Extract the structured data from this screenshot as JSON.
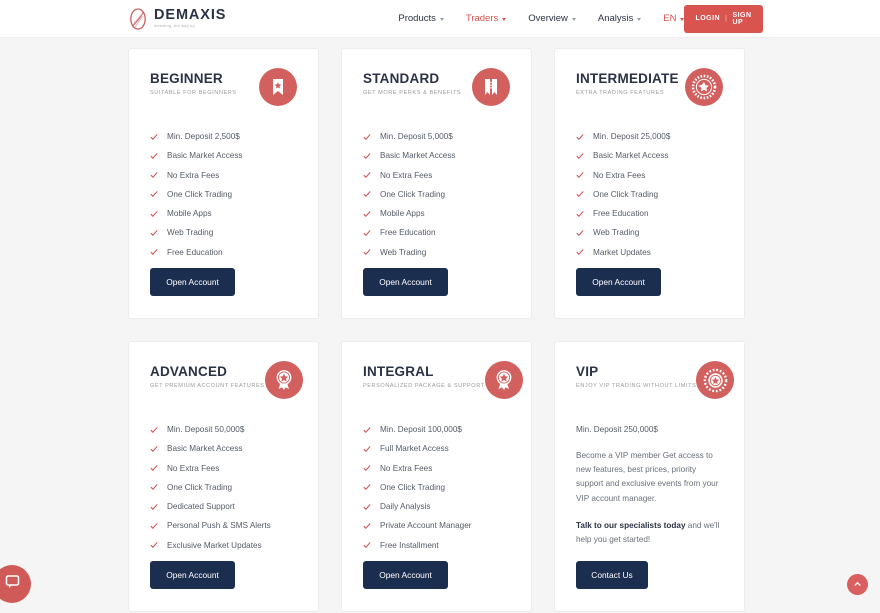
{
  "brand": {
    "name": "DEMAXIS",
    "tagline": "investing, the way up",
    "logo_icon": "demaxis-leaf-logo"
  },
  "nav": {
    "items": [
      {
        "label": "Products",
        "accent": false
      },
      {
        "label": "Traders",
        "accent": true
      },
      {
        "label": "Overview",
        "accent": false
      },
      {
        "label": "Analysis",
        "accent": false
      },
      {
        "label": "EN",
        "accent": true
      }
    ],
    "auth": {
      "login": "LOGIN",
      "separator": "|",
      "signup": "SIGN UP"
    }
  },
  "colors": {
    "accent_red": "#d9534f",
    "badge_red": "#d2605f",
    "button_navy": "#1c2e4f",
    "title_navy": "#2b3245",
    "page_bg": "#f5f5f5"
  },
  "cards": [
    {
      "title": "BEGINNER",
      "subtitle": "SUITABLE FOR BEGINNERS",
      "badge_icon": "ribbon-star-icon",
      "features": [
        "Min. Deposit 2,500$",
        "Basic Market Access",
        "No Extra Fees",
        "One Click Trading",
        "Mobile Apps",
        "Web Trading",
        "Free Education"
      ],
      "cta": "Open Account"
    },
    {
      "title": "STANDARD",
      "subtitle": "GET MORE PERKS & BENEFITS",
      "badge_icon": "double-ribbon-icon",
      "features": [
        "Min. Deposit 5,000$",
        "Basic Market Access",
        "No Extra Fees",
        "One Click Trading",
        "Mobile Apps",
        "Free Education",
        "Web Trading"
      ],
      "cta": "Open Account"
    },
    {
      "title": "INTERMEDIATE",
      "subtitle": "EXTRA TRADING FEATURES",
      "badge_icon": "starburst-seal-icon",
      "features": [
        "Min. Deposit 25,000$",
        "Basic Market Access",
        "No Extra Fees",
        "One Click Trading",
        "Free Education",
        "Web Trading",
        "Market Updates"
      ],
      "cta": "Open Account"
    },
    {
      "title": "ADVANCED",
      "subtitle": "GET PREMIUM ACCOUNT FEATURES",
      "badge_icon": "award-rosette-icon",
      "features": [
        "Min. Deposit 50,000$",
        "Basic Market Access",
        "No Extra Fees",
        "One Click Trading",
        "Dedicated Support",
        "Personal Push & SMS Alerts",
        "Exclusive Market Updates"
      ],
      "cta": "Open Account"
    },
    {
      "title": "INTEGRAL",
      "subtitle": "PERSONALIZED PACKAGE & SUPPORT",
      "badge_icon": "award-rosette-icon",
      "features": [
        "Min. Deposit 100,000$",
        "Full Market Access",
        "No Extra Fees",
        "One Click Trading",
        "Daily Analysis",
        "Private Account Manager",
        "Free Installment"
      ],
      "cta": "Open Account"
    }
  ],
  "vip_card": {
    "title": "VIP",
    "subtitle": "ENJOY VIP TRADING WITHOUT LIMITS",
    "badge_icon": "vip-medal-icon",
    "deposit": "Min. Deposit 250,000$",
    "paragraph": "Become a VIP member Get access to new features, best prices, priority support and exclusive events from your VIP account manager.",
    "cta_lead": "Talk to our specialists today",
    "cta_tail": " and we'll help you get started!",
    "cta": "Contact Us"
  },
  "widgets": {
    "chat_icon": "chat-bubble-icon",
    "scroll_top_icon": "chevron-up-icon"
  }
}
